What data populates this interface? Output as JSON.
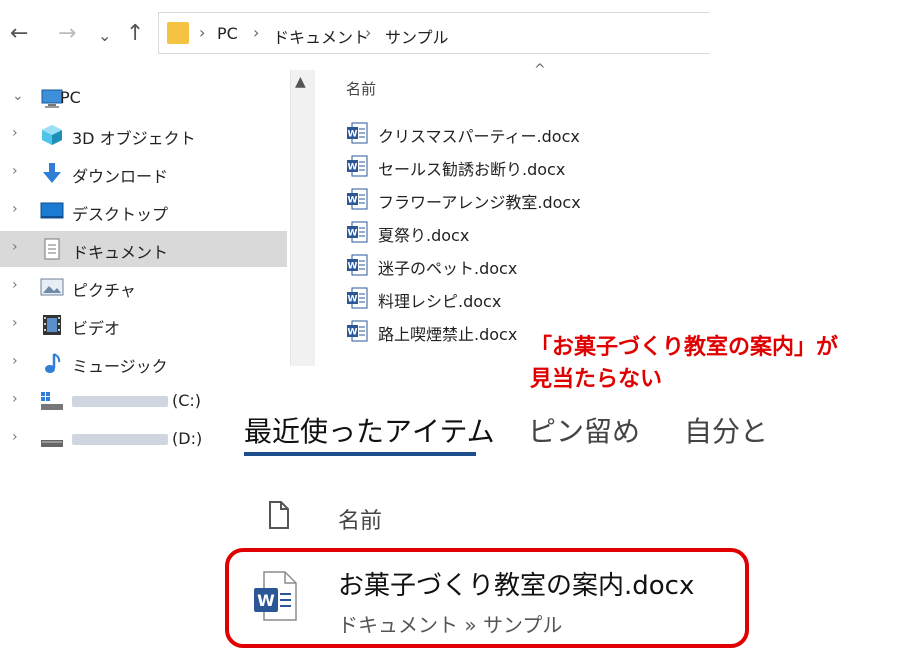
{
  "nav": {
    "back": "←",
    "forward": "→",
    "recent": "⌄",
    "up": "↑",
    "breadcrumb": [
      "PC",
      "ドキュメント",
      "サンプル"
    ],
    "separator": "›"
  },
  "tree": {
    "items": [
      {
        "label": "PC",
        "icon": "computer-icon",
        "expanded": true
      },
      {
        "label": "3D オブジェクト",
        "icon": "cube-icon"
      },
      {
        "label": "ダウンロード",
        "icon": "download-icon"
      },
      {
        "label": "デスクトップ",
        "icon": "desktop-icon"
      },
      {
        "label": "ドキュメント",
        "icon": "document-icon",
        "selected": true
      },
      {
        "label": "ピクチャ",
        "icon": "pictures-icon"
      },
      {
        "label": "ビデオ",
        "icon": "video-icon"
      },
      {
        "label": "ミュージック",
        "icon": "music-icon"
      },
      {
        "label": "(C:)",
        "icon": "drive-c-icon"
      },
      {
        "label": "(D:)",
        "icon": "drive-d-icon"
      }
    ]
  },
  "filelist": {
    "column_header": "名前",
    "sort_indicator": "^",
    "files": [
      "クリスマスパーティー.docx",
      "セールス勧誘お断り.docx",
      "フラワーアレンジ教室.docx",
      "夏祭り.docx",
      "迷子のペット.docx",
      "料理レシピ.docx",
      "路上喫煙禁止.docx"
    ]
  },
  "annotation": {
    "line1": "「お菓子づくり教室の案内」が",
    "line2": "見当たらない"
  },
  "recent": {
    "tabs": [
      "最近使ったアイテム",
      "ピン留め",
      "自分と"
    ],
    "column_header": "名前",
    "item": {
      "title": "お菓子づくり教室の案内.docx",
      "path": "ドキュメント » サンプル"
    }
  },
  "colors": {
    "accent": "#1f4e8c",
    "annotation": "#e00000",
    "word": "#2b5797",
    "selected_row": "#d9d9d9"
  }
}
